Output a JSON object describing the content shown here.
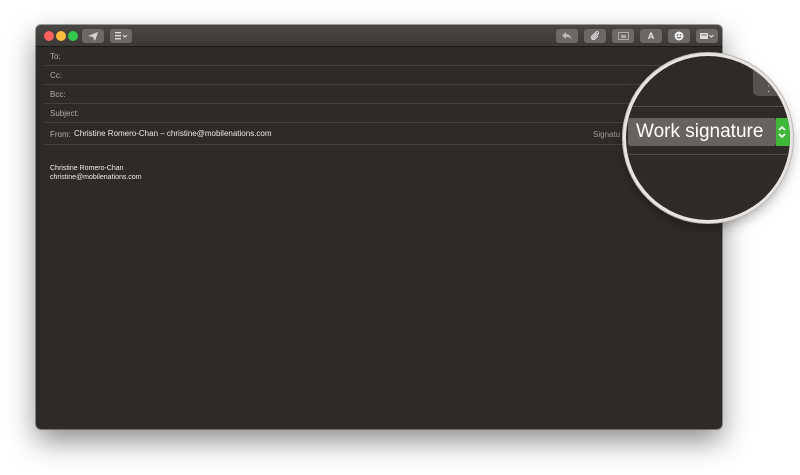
{
  "titlebar": {
    "buttons": [
      {
        "name": "send-icon"
      },
      {
        "name": "header-fields-icon"
      },
      {
        "name": "reply-icon"
      },
      {
        "name": "attachment-icon"
      },
      {
        "name": "photo-browser-icon"
      },
      {
        "name": "format-text-icon",
        "label": "A"
      },
      {
        "name": "emoji-icon"
      },
      {
        "name": "stationery-icon"
      }
    ]
  },
  "fields": {
    "to_label": "To:",
    "cc_label": "Cc:",
    "bcc_label": "Bcc:",
    "subject_label": "Subject:",
    "from_label": "From:",
    "from_value": "Christine Romero-Chan – christine@mobilenations.com",
    "signature_label": "Signatu"
  },
  "body": {
    "signature_name": "Christine Romero-Chan",
    "signature_email": "christine@mobilenations.com"
  },
  "magnifier": {
    "signature_value": "Work signature"
  },
  "colors": {
    "window_bg": "#2e2a27",
    "stepper_green": "#3fb83a",
    "close": "#fc605c",
    "minimize": "#fdbc40",
    "maximize": "#34c84a"
  }
}
